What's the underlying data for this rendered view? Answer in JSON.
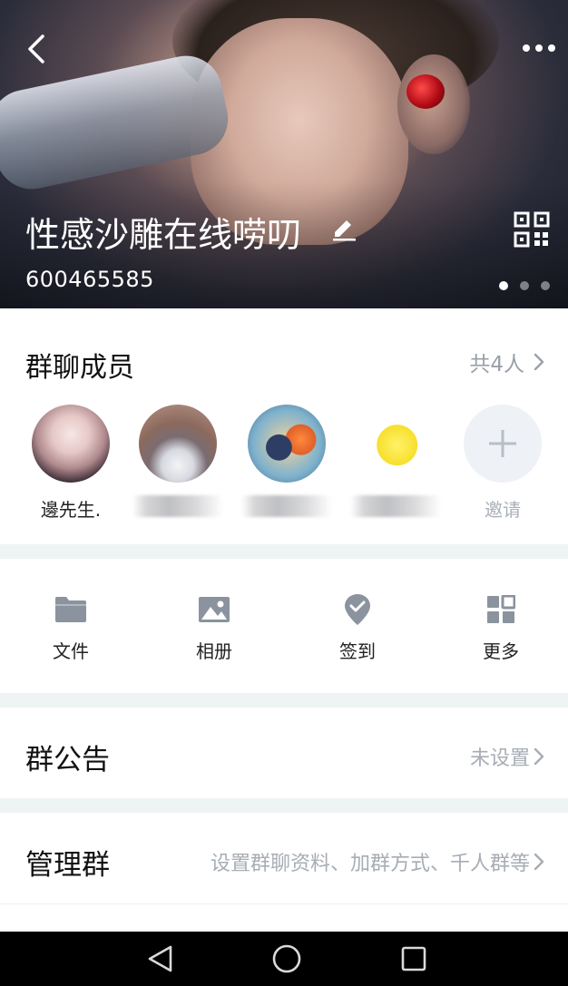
{
  "header": {
    "group_name": "性感沙雕在线唠叨",
    "group_id": "600465585",
    "carousel_total": 3,
    "carousel_active": 1
  },
  "members": {
    "title": "群聊成员",
    "count_label": "共4人",
    "list": [
      {
        "name": "邊先生.",
        "blurred": false
      },
      {
        "name": "",
        "blurred": true
      },
      {
        "name": "",
        "blurred": true
      },
      {
        "name": "",
        "blurred": true
      }
    ],
    "invite_label": "邀请"
  },
  "actions": [
    {
      "label": "文件",
      "icon": "folder-icon"
    },
    {
      "label": "相册",
      "icon": "photo-album-icon"
    },
    {
      "label": "签到",
      "icon": "check-in-icon"
    },
    {
      "label": "更多",
      "icon": "grid-more-icon"
    }
  ],
  "announcement": {
    "title": "群公告",
    "value": "未设置"
  },
  "manage": {
    "title": "管理群",
    "value": "设置群聊资料、加群方式、千人群等"
  },
  "colors": {
    "accent_gray": "#9aa0a8",
    "divider": "#eef3f4",
    "icon_gray": "#8a939e"
  }
}
